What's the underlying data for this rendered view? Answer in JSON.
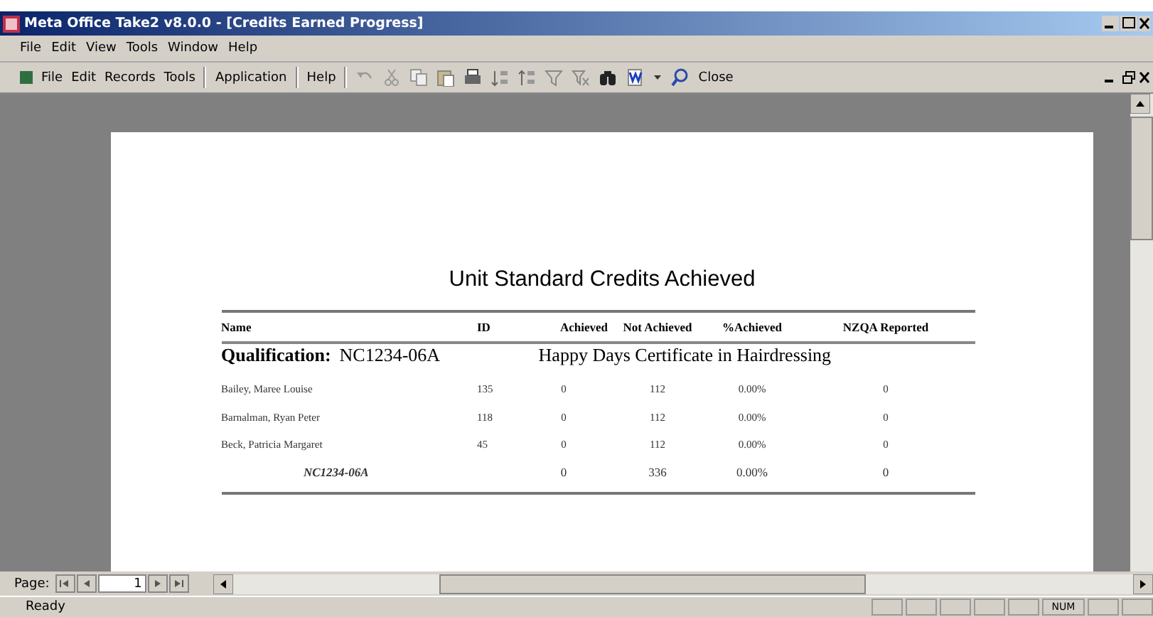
{
  "window": {
    "title": "Meta Office Take2 v8.0.0 - [Credits Earned Progress]"
  },
  "menu_bar": [
    "File",
    "Edit",
    "View",
    "Tools",
    "Window",
    "Help"
  ],
  "toolbar": {
    "menus": [
      "File",
      "Edit",
      "Records",
      "Tools"
    ],
    "application": "Application",
    "help": "Help",
    "close": "Close"
  },
  "report": {
    "title": "Unit Standard Credits Achieved",
    "columns": [
      "Name",
      "ID",
      "Achieved",
      "Not Achieved",
      "%Achieved",
      "NZQA Reported"
    ],
    "qualification": {
      "label": "Qualification:",
      "code": "NC1234-06A",
      "name": "Happy Days Certificate in Hairdressing"
    },
    "rows": [
      {
        "name": "Bailey, Maree Louise",
        "id": "135",
        "achieved": "0",
        "not_achieved": "112",
        "percent": "0.00%",
        "reported": "0"
      },
      {
        "name": "Barnalman, Ryan Peter",
        "id": "118",
        "achieved": "0",
        "not_achieved": "112",
        "percent": "0.00%",
        "reported": "0"
      },
      {
        "name": "Beck, Patricia Margaret",
        "id": "45",
        "achieved": "0",
        "not_achieved": "112",
        "percent": "0.00%",
        "reported": "0"
      }
    ],
    "total": {
      "label": "NC1234-06A",
      "achieved": "0",
      "not_achieved": "336",
      "percent": "0.00%",
      "reported": "0"
    }
  },
  "navigation": {
    "label": "Page:",
    "page": "1"
  },
  "status_bar": {
    "text": "Ready",
    "indicator": "NUM"
  }
}
